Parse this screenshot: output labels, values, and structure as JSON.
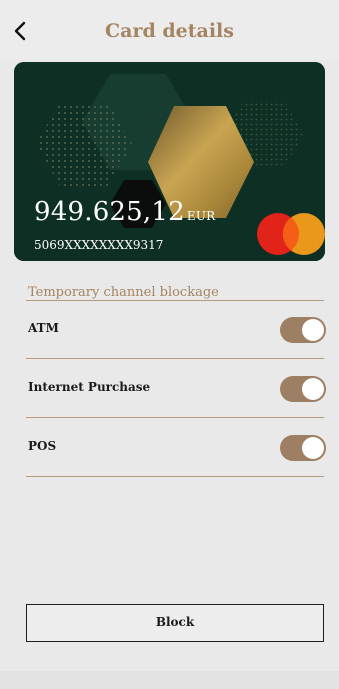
{
  "header": {
    "title": "Card details",
    "back_icon": "chevron-left-icon"
  },
  "card": {
    "balance": "949.625,12",
    "currency": "EUR",
    "number": "5069XXXXXXXX9317",
    "brand_icon": "mastercard-logo",
    "colors": {
      "background": "#0e2f24",
      "gold": "#b7924a",
      "mc_red": "#e2231a",
      "mc_orange": "#f79e1b"
    }
  },
  "channels": {
    "title": "Temporary channel blockage",
    "items": [
      {
        "label": "ATM",
        "enabled": true
      },
      {
        "label": "Internet Purchase",
        "enabled": true
      },
      {
        "label": "POS",
        "enabled": true
      }
    ]
  },
  "actions": {
    "block_label": "Block"
  },
  "theme": {
    "accent": "#a58462",
    "toggle_on": "#9d7f64"
  }
}
